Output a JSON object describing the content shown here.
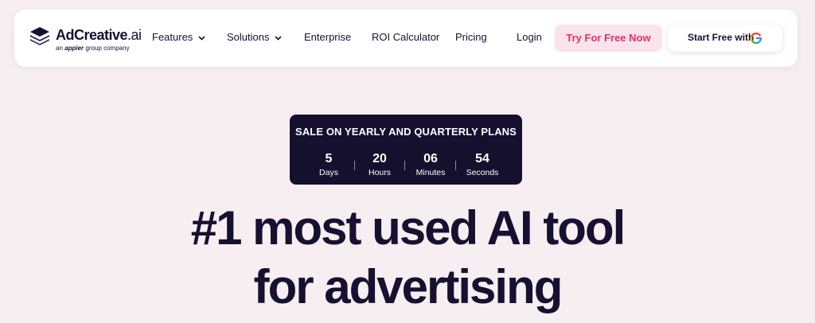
{
  "brand": {
    "name": "AdCreative",
    "name_suffix": ".ai",
    "tagline_prefix": "an",
    "tagline_brand": "appier",
    "tagline_suffix": "group company"
  },
  "nav": {
    "features": "Features",
    "solutions": "Solutions",
    "enterprise": "Enterprise",
    "roi_calculator": "ROI Calculator",
    "pricing": "Pricing",
    "login": "Login",
    "try_free": "Try For Free Now",
    "start_free_google": "Start Free with"
  },
  "sale": {
    "title": "SALE ON YEARLY AND QUARTERLY PLANS",
    "countdown": [
      {
        "value": "5",
        "unit": "Days"
      },
      {
        "value": "20",
        "unit": "Hours"
      },
      {
        "value": "06",
        "unit": "Minutes"
      },
      {
        "value": "54",
        "unit": "Seconds"
      }
    ]
  },
  "hero": {
    "line1": "#1 most used AI tool",
    "line2": "for advertising"
  },
  "colors": {
    "background": "#f6eef0",
    "text": "#161130",
    "accent_pink": "#e0306f",
    "pink_bg": "#fbe3ea",
    "banner_bg": "#15102d"
  },
  "icons": {
    "logo": "stacked-layers-icon",
    "dropdown": "chevron-down-icon",
    "google": "google-g-icon"
  }
}
